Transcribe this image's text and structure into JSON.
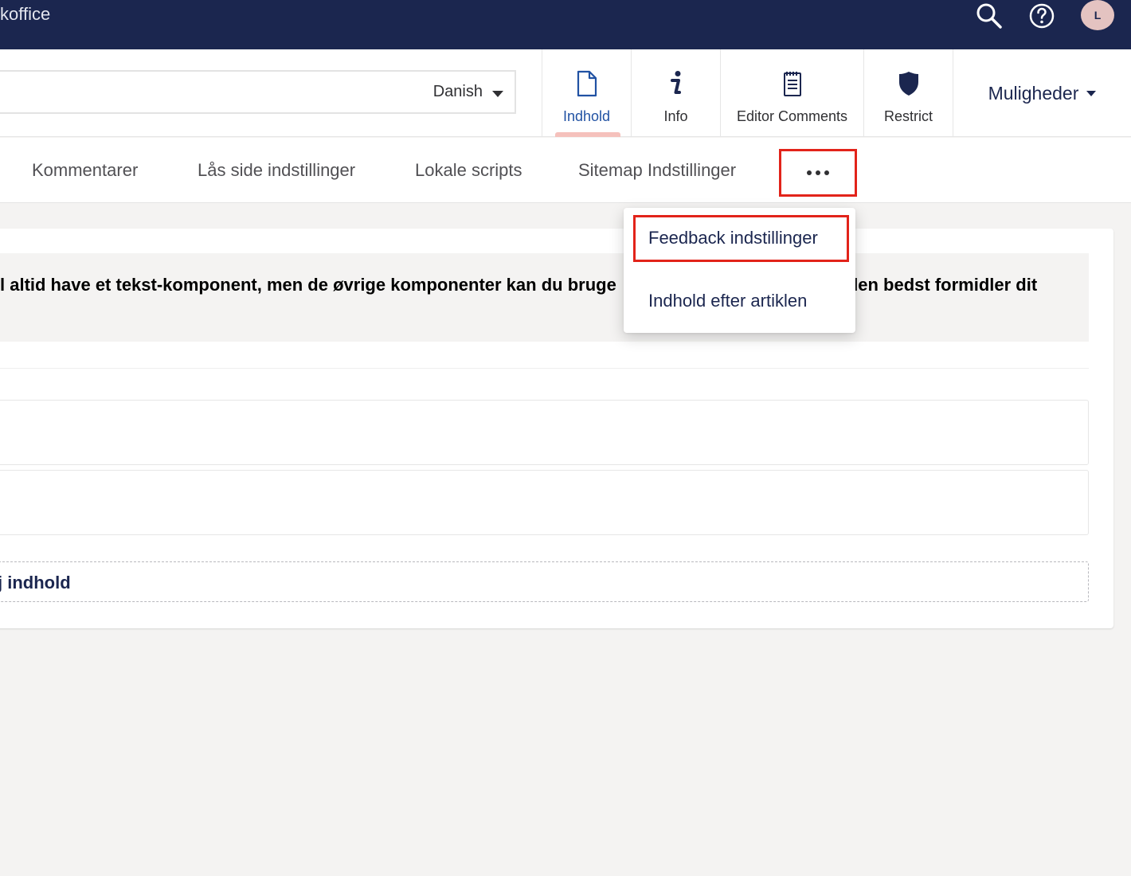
{
  "app": {
    "title": "koffice"
  },
  "topbar": {
    "search_icon": "search-icon",
    "help_icon": "help-circle-icon",
    "avatar_initial": "L",
    "bg_color": "#1b264f"
  },
  "editor": {
    "name_value": "",
    "language": "Danish",
    "apps": [
      {
        "label": "Indhold",
        "icon": "document-icon",
        "active": true
      },
      {
        "label": "Info",
        "icon": "info-icon"
      },
      {
        "label": "Editor Comments",
        "icon": "notepad-icon"
      },
      {
        "label": "Restrict",
        "icon": "shield-icon"
      }
    ],
    "actions_label": "Muligheder"
  },
  "subtabs": {
    "items": [
      "Kommentarer",
      "Lås side indstillinger",
      "Lokale scripts",
      "Sitemap Indstillinger"
    ],
    "more_icon": "more-horizontal-icon"
  },
  "dropdown": {
    "items": [
      "Feedback indstillinger",
      "Indhold efter artiklen"
    ]
  },
  "content": {
    "notice_before": "l altid have et tekst-komponent, men de øvrige komponenter kan du bruge",
    "notice_after": "den bedst formidler dit",
    "add_label": "j indhold"
  },
  "colors": {
    "accent": "#2152a3",
    "highlight": "#e2231a",
    "active_tab_bar": "#f5c1bc"
  }
}
